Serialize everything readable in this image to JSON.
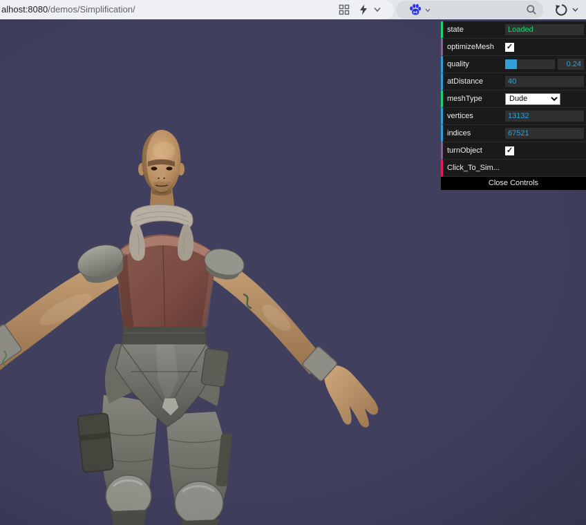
{
  "browser": {
    "url_host": "alhost:8080",
    "url_path": "/demos/Simplification/"
  },
  "gui": {
    "colors": {
      "string": "#1ed36f",
      "boolean": "#806787",
      "number": "#2FA1D6",
      "function": "#e61d5f"
    },
    "check_glyph": "✓",
    "rows": [
      {
        "type": "string",
        "label": "state",
        "value": "Loaded"
      },
      {
        "type": "boolean",
        "label": "optimizeMesh",
        "checked": true
      },
      {
        "type": "number",
        "label": "quality",
        "value": "0.24",
        "fraction_pct": "24%"
      },
      {
        "type": "number",
        "label": "atDistance",
        "value": "40"
      },
      {
        "type": "select",
        "label": "meshType",
        "value": "Dude"
      },
      {
        "type": "number",
        "label": "vertices",
        "value": "13132"
      },
      {
        "type": "number",
        "label": "indices",
        "value": "67521"
      },
      {
        "type": "boolean",
        "label": "turnObject",
        "checked": true
      },
      {
        "type": "function",
        "label": "Click_To_Sim..."
      }
    ],
    "close_button": "Close Controls"
  },
  "scene": {
    "background": "#403f5e",
    "model_name": "Dude"
  }
}
